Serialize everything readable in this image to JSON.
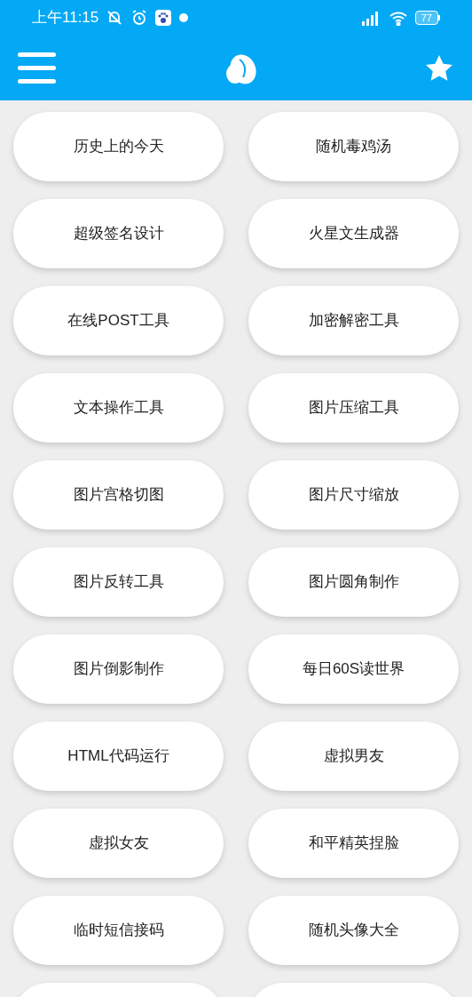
{
  "status_bar": {
    "time": "上午11:15",
    "battery": "77"
  },
  "tools": [
    {
      "label": "历史上的今天"
    },
    {
      "label": "随机毒鸡汤"
    },
    {
      "label": "超级签名设计"
    },
    {
      "label": "火星文生成器"
    },
    {
      "label": "在线POST工具"
    },
    {
      "label": "加密解密工具"
    },
    {
      "label": "文本操作工具"
    },
    {
      "label": "图片压缩工具"
    },
    {
      "label": "图片宫格切图"
    },
    {
      "label": "图片尺寸缩放"
    },
    {
      "label": "图片反转工具"
    },
    {
      "label": "图片圆角制作"
    },
    {
      "label": "图片倒影制作"
    },
    {
      "label": "每日60S读世界"
    },
    {
      "label": "HTML代码运行"
    },
    {
      "label": "虚拟男友"
    },
    {
      "label": "虚拟女友"
    },
    {
      "label": "和平精英捏脸"
    },
    {
      "label": "临时短信接码"
    },
    {
      "label": "随机头像大全"
    }
  ]
}
